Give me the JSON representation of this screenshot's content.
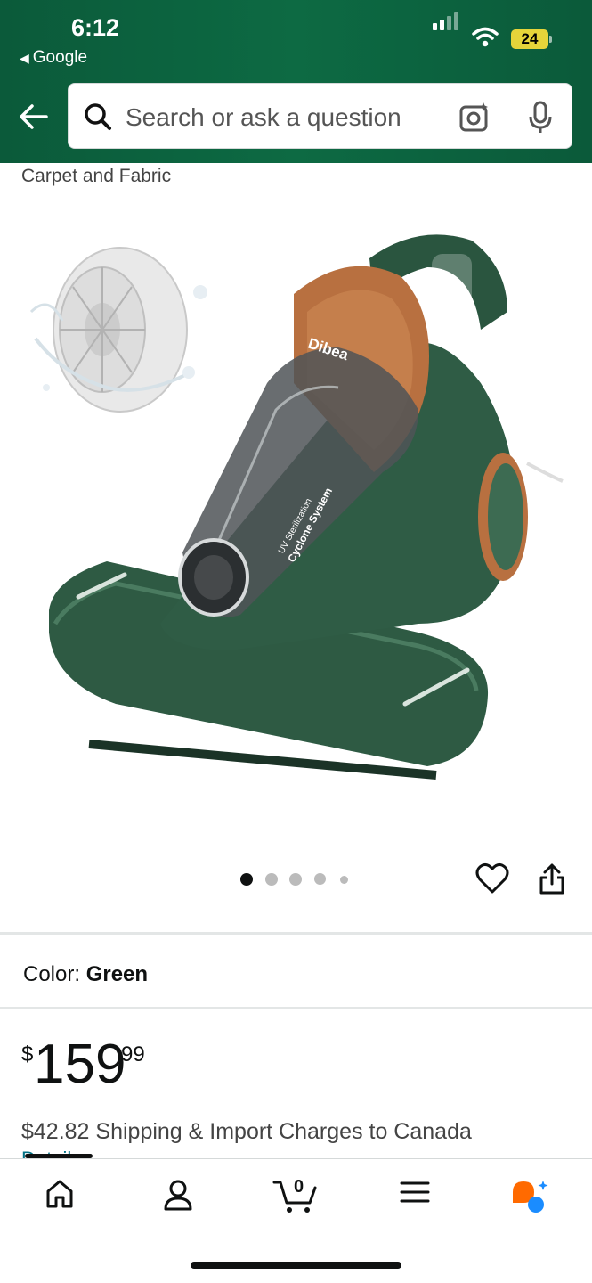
{
  "status_bar": {
    "time": "6:12",
    "back_app": "Google",
    "battery": "24"
  },
  "header": {
    "search_placeholder": "Search or ask a question"
  },
  "product": {
    "subtitle": "Carpet and Fabric",
    "image_count": 5,
    "active_image": 1,
    "color_label": "Color:",
    "color_value": "Green",
    "price_symbol": "$",
    "price_whole": "159",
    "price_fraction": "99",
    "shipping": "$42.82 Shipping & Import Charges to Canada",
    "details_link": "Details",
    "image_texts": {
      "brand": "Dibea",
      "label_line1": "UV Sterilization",
      "label_line2": "Cyclone System"
    }
  },
  "bottom_nav": {
    "cart_count": "0"
  },
  "colors": {
    "header_bg": "#0b5a3a",
    "product_green": "#2f5c45",
    "accent_copper": "#b87040",
    "link": "#007185"
  }
}
